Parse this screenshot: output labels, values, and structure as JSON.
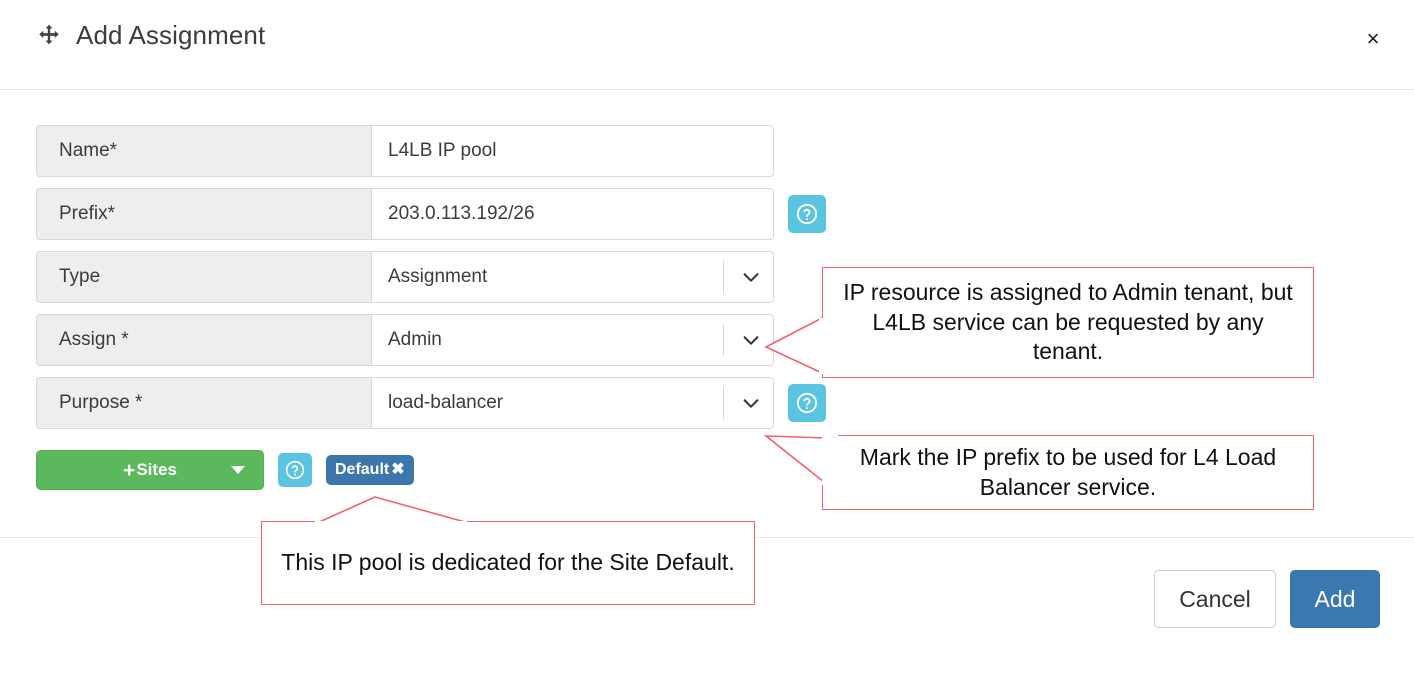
{
  "dialog": {
    "title": "Add Assignment",
    "title_icon": "move-arrows-icon",
    "close_label": "×"
  },
  "form": {
    "rows": [
      {
        "label": "Name*",
        "value": "L4LB IP pool",
        "control": "text",
        "help": false
      },
      {
        "label": "Prefix*",
        "value": "203.0.113.192/26",
        "control": "text",
        "help": true
      },
      {
        "label": "Type",
        "value": "Assignment",
        "control": "select",
        "help": false
      },
      {
        "label": "Assign *",
        "value": "Admin",
        "control": "select",
        "help": false
      },
      {
        "label": "Purpose *",
        "value": "load-balancer",
        "control": "select",
        "help": true
      }
    ]
  },
  "sites": {
    "button_plus": "+",
    "button_label": "Sites",
    "help_icon": "question-mark-icon",
    "tags": [
      {
        "label": "Default",
        "remove": "✖"
      }
    ]
  },
  "footer": {
    "cancel_label": "Cancel",
    "add_label": "Add"
  },
  "annotations": [
    {
      "id": "assign",
      "text": "IP resource is assigned to Admin tenant, but L4LB service can be requested by any tenant."
    },
    {
      "id": "purpose",
      "text": "Mark the IP prefix to be used for L4 Load Balancer service."
    },
    {
      "id": "sites",
      "text": "This IP pool is dedicated for the Site Default."
    }
  ],
  "colors": {
    "accent_blue": "#3b77b0",
    "help_cyan": "#5bc4e0",
    "sites_green": "#5cb85c",
    "tag_blue": "#3d76ad",
    "annotation_red": "#f4606c",
    "label_bg": "#eeeeee"
  }
}
